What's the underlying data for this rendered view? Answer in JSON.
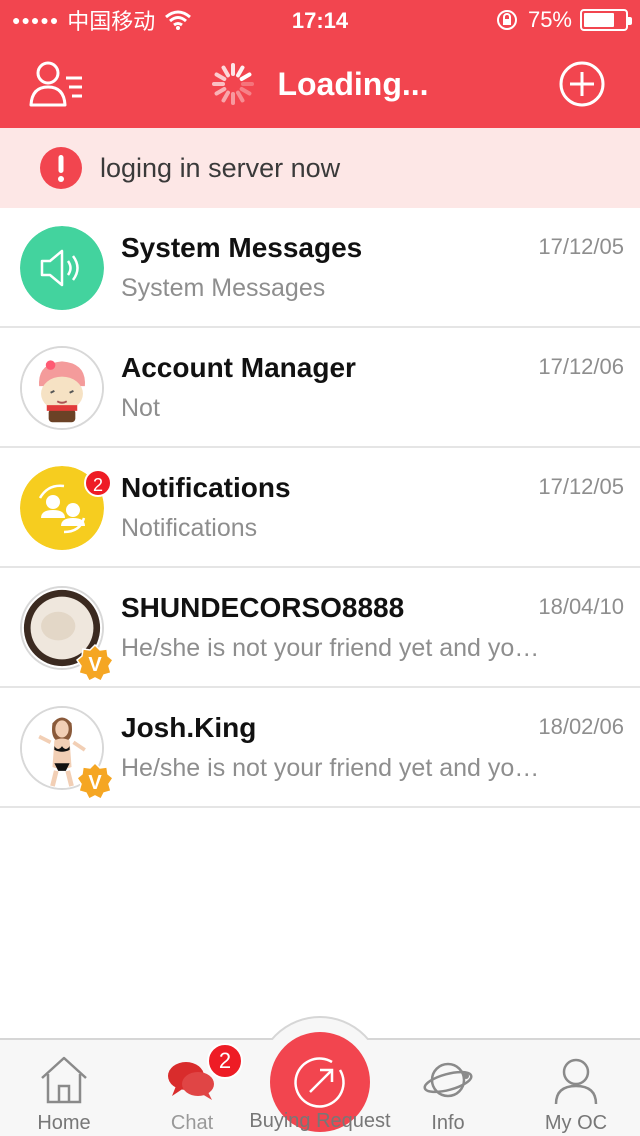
{
  "status_bar": {
    "signal_dots": "●●●●●",
    "carrier": "中国移动",
    "time": "17:14",
    "battery_percent": "75%",
    "battery_level": 0.75
  },
  "nav": {
    "title": "Loading...",
    "left_icon": "contacts-menu-icon",
    "right_icon": "add-circle-icon"
  },
  "banner": {
    "icon": "alert-icon",
    "message": "loging in server now"
  },
  "conversations": [
    {
      "name": "System Messages",
      "preview": "System Messages",
      "date": "17/12/05",
      "avatar": "speaker-icon"
    },
    {
      "name": "Account Manager",
      "preview": "Not",
      "date": "17/12/06",
      "avatar": "cartoon-avatar"
    },
    {
      "name": "Notifications",
      "preview": "Notifications",
      "date": "17/12/05",
      "avatar": "users-sync-icon",
      "badge": "2"
    },
    {
      "name": "SHUNDECORSO8888",
      "preview": "He/she is not your friend yet and you can only send one message",
      "date": "18/04/10",
      "avatar": "photo-avatar",
      "verified": "V"
    },
    {
      "name": "Josh.King",
      "preview": "He/she is not your friend yet and you can only send one message",
      "date": "18/02/06",
      "avatar": "photo-avatar",
      "verified": "V"
    }
  ],
  "tabbar": {
    "tabs": [
      {
        "label": "Home",
        "icon": "home-icon"
      },
      {
        "label": "Chat",
        "icon": "chat-bubbles-icon",
        "badge": "2"
      },
      {
        "label": "Buying Request",
        "icon": "arrow-circle-icon"
      },
      {
        "label": "Info",
        "icon": "planet-icon"
      },
      {
        "label": "My OC",
        "icon": "person-icon"
      }
    ]
  },
  "colors": {
    "brand_red": "#f2454f",
    "banner_bg": "#fde7e6",
    "badge_red": "#ee1c25",
    "verified_orange": "#f5a623",
    "system_green": "#43d39e",
    "notify_yellow": "#f6cd1f"
  }
}
